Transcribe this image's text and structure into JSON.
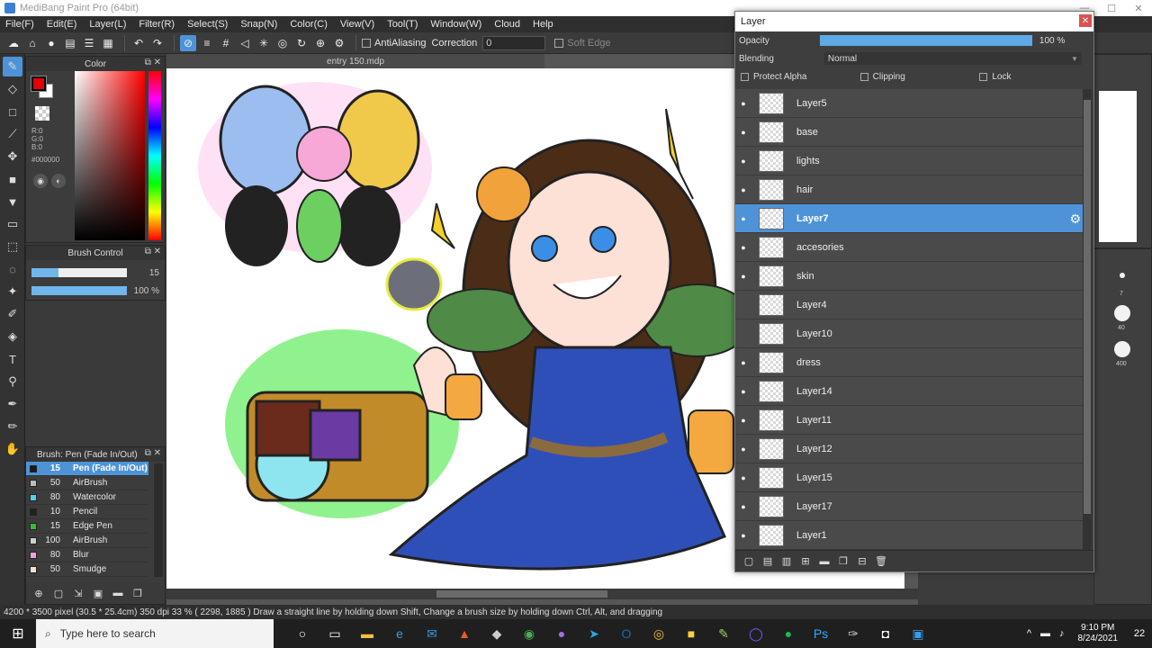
{
  "window": {
    "title": "MediBang Paint Pro (64bit)",
    "controls": [
      "—",
      "☐",
      "✕"
    ]
  },
  "menu": [
    "File(F)",
    "Edit(E)",
    "Layer(L)",
    "Filter(R)",
    "Select(S)",
    "Snap(N)",
    "Color(C)",
    "View(V)",
    "Tool(T)",
    "Window(W)",
    "Cloud",
    "Help"
  ],
  "toolbar": {
    "antialiasing_label": "AntiAliasing",
    "correction_label": "Correction",
    "correction_value": "0",
    "soft_edge_label": "Soft Edge"
  },
  "color_panel": {
    "title": "Color",
    "rgb": "R:0\nG:0\nB:0",
    "hex": "#000000",
    "fg_color": "#e60000",
    "bg_color": "#ffffff"
  },
  "brush_control": {
    "title": "Brush Control",
    "size_value": "15",
    "opacity_value": "100 %",
    "size_fraction": 0.28,
    "opacity_fraction": 1.0
  },
  "brush_list": {
    "title": "Brush: Pen (Fade In/Out)",
    "items": [
      {
        "size": "15",
        "name": "Pen (Fade In/Out)",
        "color": "#1a1a1a",
        "selected": true
      },
      {
        "size": "50",
        "name": "AirBrush",
        "color": "#bbbbbb",
        "selected": false
      },
      {
        "size": "80",
        "name": "Watercolor",
        "color": "#4fd1f0",
        "selected": false
      },
      {
        "size": "10",
        "name": "Pencil",
        "color": "#222222",
        "selected": false
      },
      {
        "size": "15",
        "name": "Edge Pen",
        "color": "#2fc12f",
        "selected": false
      },
      {
        "size": "100",
        "name": "AirBrush",
        "color": "#cfcfcf",
        "selected": false
      },
      {
        "size": "80",
        "name": "Blur",
        "color": "#f0a0e0",
        "selected": false
      },
      {
        "size": "50",
        "name": "Smudge",
        "color": "#f5e0d0",
        "selected": false
      }
    ]
  },
  "document": {
    "tab_title": "entry 150.mdp"
  },
  "layer_panel": {
    "title": "Layer",
    "opacity_label": "Opacity",
    "opacity_value": "100 %",
    "opacity_fraction": 1.0,
    "blending_label": "Blending",
    "blending_value": "Normal",
    "protect_alpha_label": "Protect Alpha",
    "clipping_label": "Clipping",
    "lock_label": "Lock",
    "layers": [
      {
        "name": "Layer5",
        "visible": true,
        "selected": false
      },
      {
        "name": "base",
        "visible": true,
        "selected": false
      },
      {
        "name": "lights",
        "visible": true,
        "selected": false
      },
      {
        "name": "hair",
        "visible": true,
        "selected": false
      },
      {
        "name": "Layer7",
        "visible": true,
        "selected": true
      },
      {
        "name": "accesories",
        "visible": true,
        "selected": false
      },
      {
        "name": "skin",
        "visible": true,
        "selected": false
      },
      {
        "name": "Layer4",
        "visible": false,
        "selected": false
      },
      {
        "name": "Layer10",
        "visible": false,
        "selected": false
      },
      {
        "name": "dress",
        "visible": true,
        "selected": false
      },
      {
        "name": "Layer14",
        "visible": true,
        "selected": false
      },
      {
        "name": "Layer11",
        "visible": true,
        "selected": false
      },
      {
        "name": "Layer12",
        "visible": true,
        "selected": false
      },
      {
        "name": "Layer15",
        "visible": true,
        "selected": false
      },
      {
        "name": "Layer17",
        "visible": true,
        "selected": false
      },
      {
        "name": "Layer1",
        "visible": true,
        "selected": false
      }
    ]
  },
  "right_dock": {
    "brush_sizes": [
      "7",
      "40",
      "400"
    ]
  },
  "status": {
    "text": "4200 * 3500 pixel   (30.5 * 25.4cm)   350 dpi   33 %   ( 2298, 1885 )   Draw a straight line by holding down Shift, Change a brush size by holding down Ctrl, Alt, and dragging"
  },
  "taskbar": {
    "search_placeholder": "Type here to search",
    "time": "9:10 PM",
    "date": "8/24/2021",
    "notification_count": "22"
  }
}
